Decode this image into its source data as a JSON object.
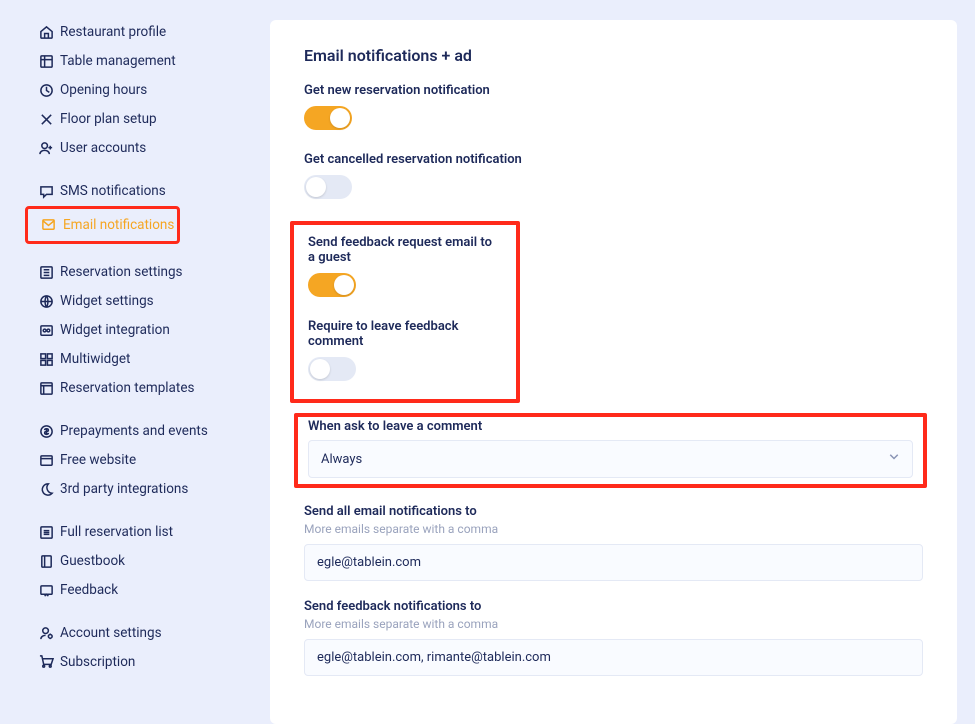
{
  "sidebar": {
    "groups": [
      {
        "items": [
          {
            "icon": "home",
            "label": "Restaurant profile"
          },
          {
            "icon": "table",
            "label": "Table management"
          },
          {
            "icon": "clock",
            "label": "Opening hours"
          },
          {
            "icon": "floor",
            "label": "Floor plan setup"
          },
          {
            "icon": "user-add",
            "label": "User accounts"
          }
        ]
      },
      {
        "items": [
          {
            "icon": "chat",
            "label": "SMS notifications"
          },
          {
            "icon": "mail",
            "label": "Email notifications",
            "active": true,
            "highlighted": true
          }
        ]
      },
      {
        "items": [
          {
            "icon": "sliders",
            "label": "Reservation settings"
          },
          {
            "icon": "globe",
            "label": "Widget settings"
          },
          {
            "icon": "widget",
            "label": "Widget integration"
          },
          {
            "icon": "grid",
            "label": "Multiwidget"
          },
          {
            "icon": "template",
            "label": "Reservation templates"
          }
        ]
      },
      {
        "items": [
          {
            "icon": "dollar",
            "label": "Prepayments and events"
          },
          {
            "icon": "window",
            "label": "Free website"
          },
          {
            "icon": "moon",
            "label": "3rd party integrations"
          }
        ]
      },
      {
        "items": [
          {
            "icon": "list",
            "label": "Full reservation list"
          },
          {
            "icon": "book",
            "label": "Guestbook"
          },
          {
            "icon": "feedback",
            "label": "Feedback"
          }
        ]
      },
      {
        "items": [
          {
            "icon": "user-cog",
            "label": "Account settings"
          },
          {
            "icon": "cart",
            "label": "Subscription"
          }
        ]
      }
    ]
  },
  "panel": {
    "title": "Email notifications + ad",
    "toggles": {
      "new_reservation": {
        "label": "Get new reservation notification",
        "value": true
      },
      "cancelled_reservation": {
        "label": "Get cancelled reservation notification",
        "value": false
      },
      "feedback_request": {
        "label": "Send feedback request email to a guest",
        "value": true
      },
      "require_comment": {
        "label": "Require to leave feedback comment",
        "value": false
      }
    },
    "ask_comment": {
      "label": "When ask to leave a comment",
      "value": "Always"
    },
    "send_all": {
      "label": "Send all email notifications to",
      "help": "More emails separate with a comma",
      "value": "egle@tablein.com"
    },
    "send_feedback": {
      "label": "Send feedback notifications to",
      "help": "More emails separate with a comma",
      "value": "egle@tablein.com, rimante@tablein.com"
    }
  }
}
